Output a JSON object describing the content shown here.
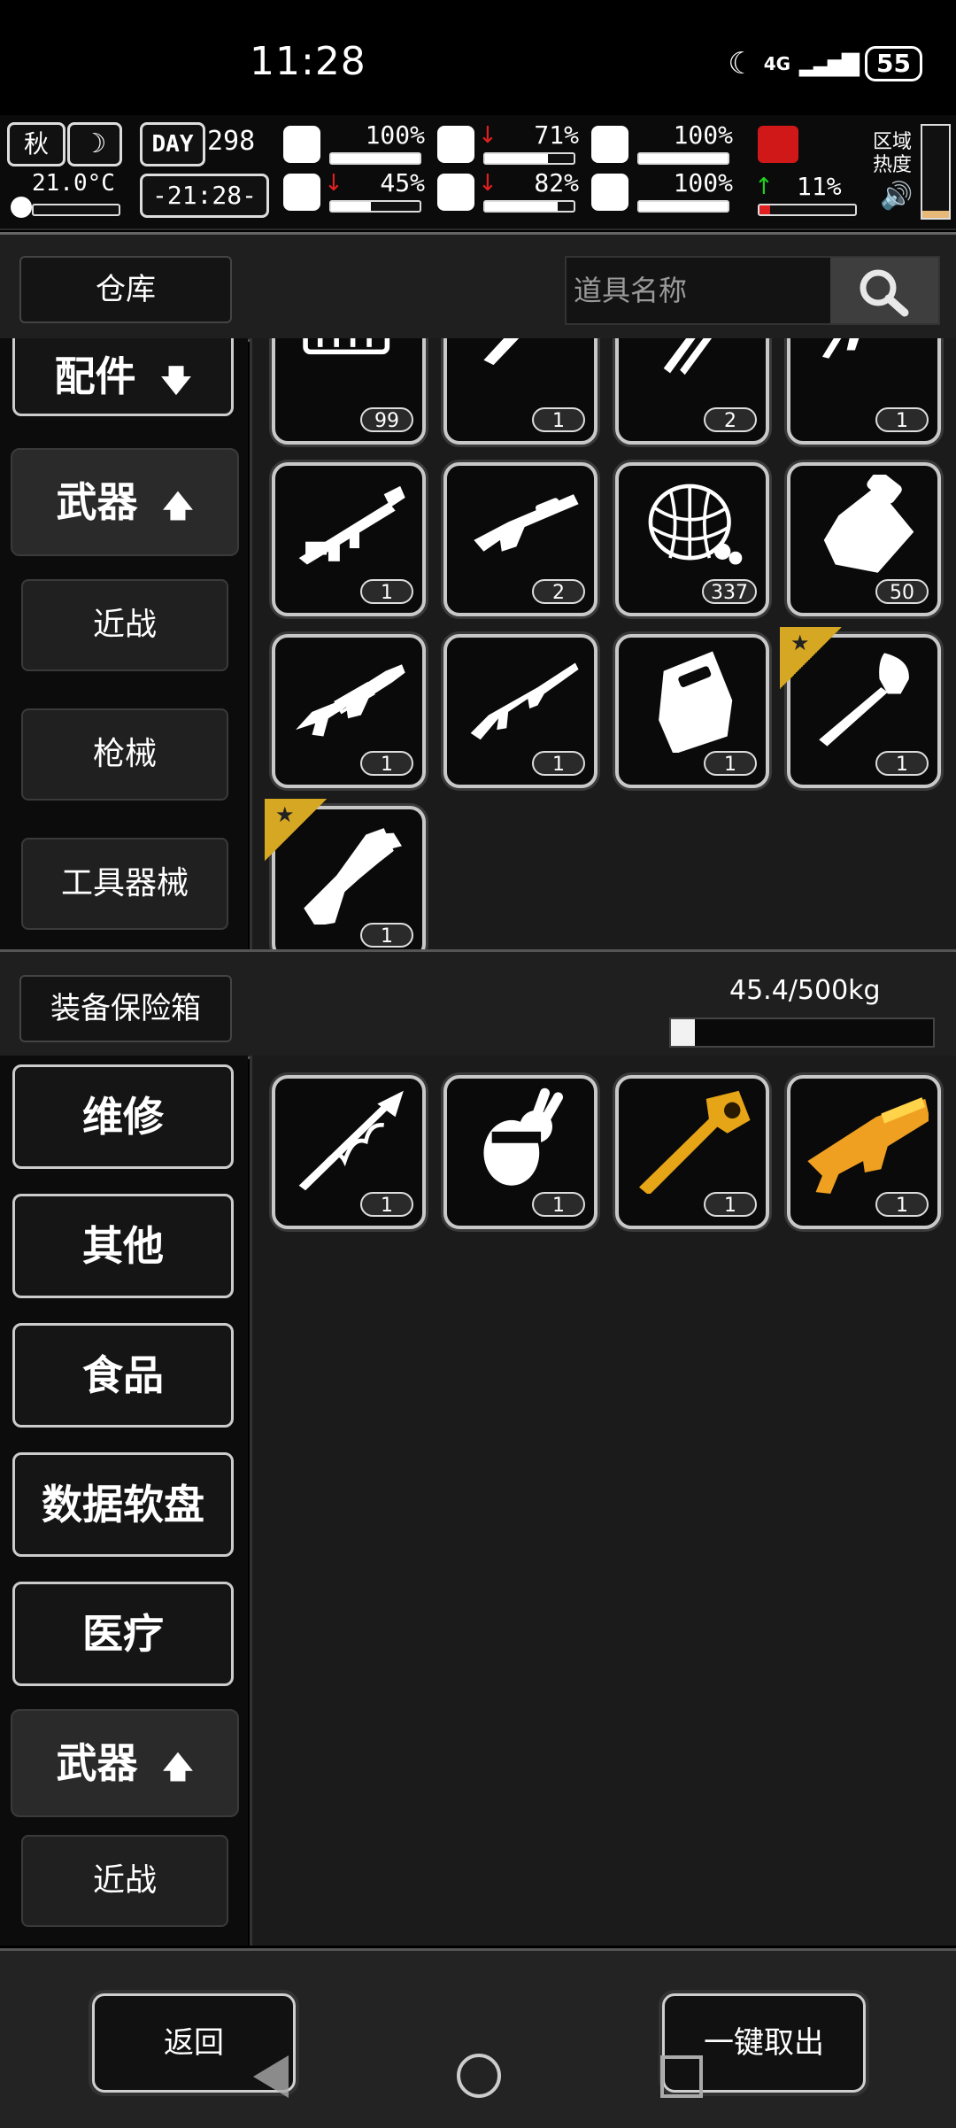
{
  "status": {
    "time": "11:28",
    "network": "4G",
    "battery": "55"
  },
  "hud": {
    "season": "秋",
    "day_label": "DAY",
    "day": "298",
    "temperature": "21.0°C",
    "clock": "-21:28-",
    "stats": [
      {
        "icon": "medkit-icon",
        "value": "100%",
        "level": 1.0,
        "trend": ""
      },
      {
        "icon": "stomach-icon",
        "value": "71%",
        "level": 0.71,
        "trend": "down"
      },
      {
        "icon": "shield-icon",
        "value": "100%",
        "level": 1.0,
        "trend": ""
      },
      {
        "icon": "brain-icon",
        "value": "45%",
        "level": 0.45,
        "trend": "down"
      },
      {
        "icon": "water-drop-icon",
        "value": "82%",
        "level": 0.82,
        "trend": "down"
      },
      {
        "icon": "heart-icon",
        "value": "100%",
        "level": 1.0,
        "trend": ""
      }
    ],
    "boot": {
      "value": "11%",
      "level": 0.11,
      "trend": "up"
    },
    "zone_label_1": "区域",
    "zone_label_2": "热度"
  },
  "warehouse": {
    "tab_label": "仓库",
    "search_placeholder": "道具名称",
    "categories": [
      {
        "label": "配件",
        "arrow": "down"
      },
      {
        "label": "武器",
        "arrow": "up"
      }
    ],
    "subcategories": [
      "近战",
      "枪械",
      "工具器械"
    ],
    "items": [
      {
        "icon": "ammo-crate-icon",
        "qty": "99"
      },
      {
        "icon": "knife-icon",
        "qty": "1"
      },
      {
        "icon": "twin-blades-icon",
        "qty": "2"
      },
      {
        "icon": "smg-icon",
        "qty": "1"
      },
      {
        "icon": "rocket-launcher-icon",
        "qty": "1"
      },
      {
        "icon": "shotgun-icon",
        "qty": "2"
      },
      {
        "icon": "net-icon",
        "qty": "337"
      },
      {
        "icon": "fuel-bag-icon",
        "qty": "50"
      },
      {
        "icon": "assault-rifle-icon",
        "qty": "1"
      },
      {
        "icon": "rifle-icon",
        "qty": "1"
      },
      {
        "icon": "riot-shield-icon",
        "qty": "1"
      },
      {
        "icon": "shovel-icon",
        "qty": "1",
        "starred": true
      },
      {
        "icon": "wrench-blade-icon",
        "qty": "1",
        "starred": true
      }
    ]
  },
  "safebox": {
    "tab_label": "装备保险箱",
    "weight": "45.4/500kg",
    "weight_fraction": 0.091,
    "categories": [
      "维修",
      "其他",
      "食品",
      "数据软盘",
      "医疗"
    ],
    "weapon_category": {
      "label": "武器",
      "arrow": "up"
    },
    "subcategory": "近战",
    "items": [
      {
        "icon": "spear-icon",
        "qty": "1",
        "color": "#ffffff"
      },
      {
        "icon": "rabbit-icon",
        "qty": "1",
        "color": "#ffffff"
      },
      {
        "icon": "golden-hammer-icon",
        "qty": "1",
        "color": "#e6a417"
      },
      {
        "icon": "golden-blaster-icon",
        "qty": "1",
        "color": "#f0a020"
      }
    ]
  },
  "footer": {
    "back_label": "返回",
    "take_all_label": "一键取出"
  },
  "colors": {
    "panel": "#1f1f1f",
    "accent_gold": "#d6a722",
    "health_red": "#e02020"
  }
}
